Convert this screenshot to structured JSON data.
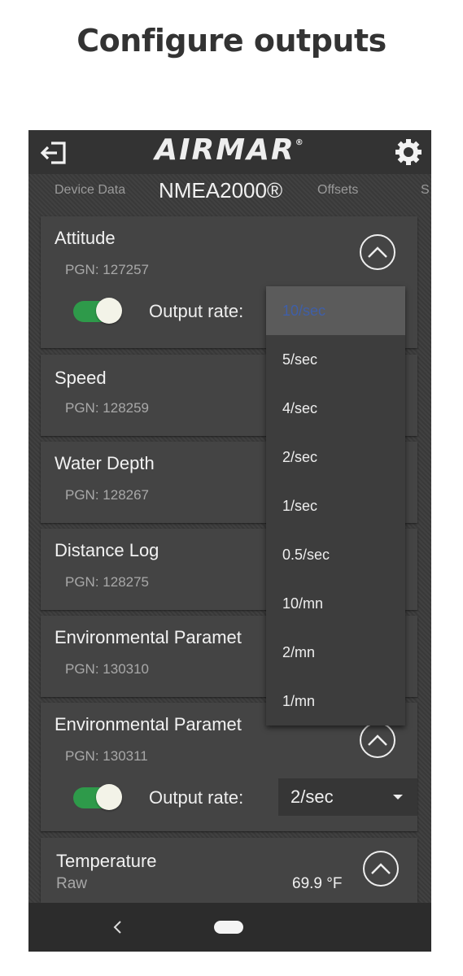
{
  "page_title": "Configure outputs",
  "header": {
    "logo_text": "AIRMAR",
    "logo_mark": "®",
    "exit_icon": "exit-icon",
    "settings_icon": "gear-icon"
  },
  "tabs": [
    {
      "label": "Device Data",
      "active": false
    },
    {
      "label": "NMEA2000®",
      "active": true
    },
    {
      "label": "Offsets",
      "active": false
    },
    {
      "label": "S",
      "active": false
    }
  ],
  "cards": [
    {
      "title": "Attitude",
      "pgn": "PGN: 127257",
      "expanded": true,
      "output_rate_label": "Output rate:",
      "output_rate": "10/sec",
      "toggle_on": true
    },
    {
      "title": "Speed",
      "pgn": "PGN: 128259"
    },
    {
      "title": "Water Depth",
      "pgn": "PGN: 128267"
    },
    {
      "title": "Distance Log",
      "pgn": "PGN: 128275"
    },
    {
      "title": "Environmental Paramet",
      "pgn": "PGN: 130310"
    },
    {
      "title": "Environmental Paramet",
      "pgn": "PGN: 130311",
      "expanded": true,
      "output_rate_label": "Output rate:",
      "output_rate": "2/sec",
      "toggle_on": true
    },
    {
      "title": "Temperature",
      "subtitle": "Raw",
      "value": "69.9 °F",
      "expanded": true
    }
  ],
  "dropdown": {
    "selected": "10/sec",
    "options": [
      "10/sec",
      "5/sec",
      "4/sec",
      "2/sec",
      "1/sec",
      "0.5/sec",
      "10/mn",
      "2/mn",
      "1/mn"
    ]
  },
  "colors": {
    "toggle_on": "#2e9a4a",
    "selected_option_text": "#3f5fa8",
    "background": "#393939"
  },
  "navbar": {
    "back_icon": "back-chevron-icon",
    "home_icon": "home-pill-icon"
  }
}
